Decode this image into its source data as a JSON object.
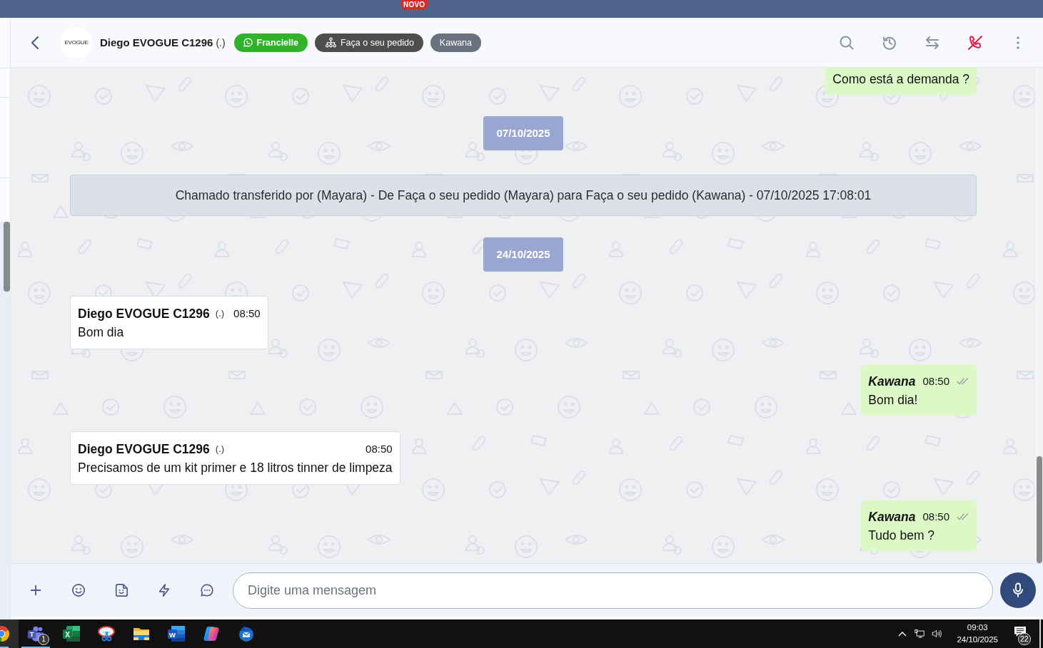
{
  "top_bar": {
    "badge": "NOVO"
  },
  "header": {
    "avatar_logo": "EVOGUE",
    "contact_name": "Diego EVOGUE C1296",
    "contact_note": "(.)",
    "tags": [
      {
        "kind": "channel",
        "label": "Francielle"
      },
      {
        "kind": "queue",
        "label": "Faça o seu pedido"
      },
      {
        "kind": "agent",
        "label": "Kawana"
      }
    ]
  },
  "messages": [
    {
      "kind": "outgoing",
      "text": "Como está a demanda ?"
    },
    {
      "kind": "date",
      "text": "07/10/2025"
    },
    {
      "kind": "system",
      "text": "Chamado transferido por (Mayara) - De Faça o seu pedido (Mayara) para Faça o seu pedido (Kawana) - 07/10/2025 17:08:01"
    },
    {
      "kind": "date",
      "text": "24/10/2025"
    },
    {
      "kind": "incoming",
      "sender": "Diego EVOGUE C1296",
      "sender_note": "(.)",
      "time": "08:50",
      "text": "Bom dia"
    },
    {
      "kind": "outgoing",
      "sender": "Kawana",
      "time": "08:50",
      "read": false,
      "text": "Bom dia!"
    },
    {
      "kind": "incoming",
      "sender": "Diego EVOGUE C1296",
      "sender_note": "(.)",
      "time": "08:50",
      "text": "Precisamos de um kit primer e 18 litros tinner de limpeza"
    },
    {
      "kind": "outgoing",
      "sender": "Kawana",
      "time": "08:50",
      "read": false,
      "text": "Tudo bem ?"
    }
  ],
  "composer": {
    "placeholder": "Digite uma mensagem"
  },
  "taskbar": {
    "apps": [
      {
        "kind": "browser",
        "running": true,
        "active": true
      },
      {
        "kind": "chat",
        "logo_letter": "T",
        "badge": "1",
        "running": true,
        "active": false
      },
      {
        "kind": "spreadsheet",
        "logo_letter": "X",
        "running": false,
        "active": false
      },
      {
        "kind": "snipping",
        "running": false,
        "active": false
      },
      {
        "kind": "files",
        "running": false,
        "active": false
      },
      {
        "kind": "word-processor",
        "logo_letter": "W",
        "running": false,
        "active": false
      },
      {
        "kind": "assistant",
        "running": false,
        "active": false
      },
      {
        "kind": "mail",
        "running": false,
        "active": false
      }
    ],
    "time": "09:03",
    "date": "24/10/2025",
    "notification_count": "22"
  }
}
